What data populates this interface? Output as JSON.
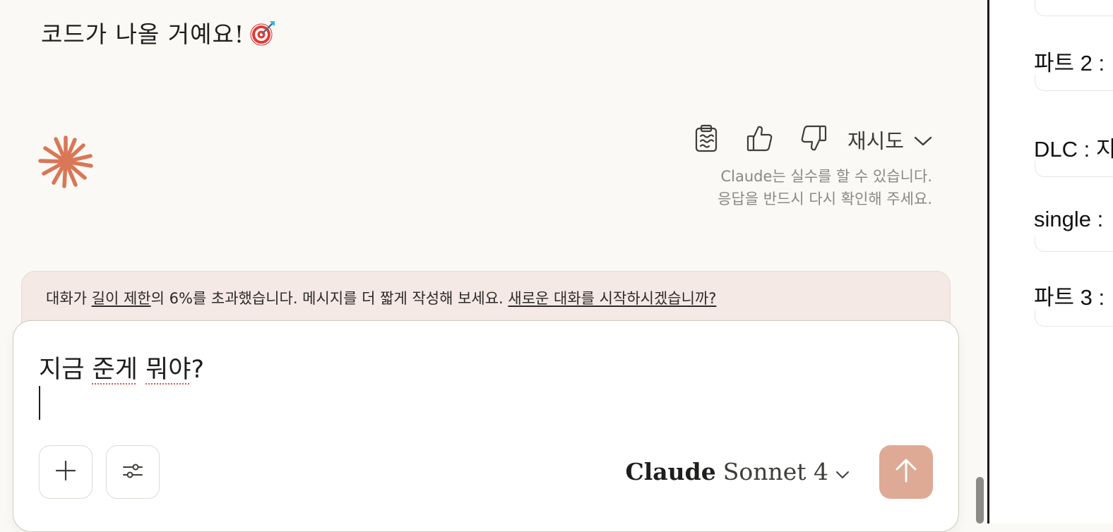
{
  "message": {
    "tail_text": "코드가 나올 거예요!",
    "emoji": "🎯"
  },
  "actions": {
    "copy_icon": "clipboard-icon",
    "thumbs_up_icon": "thumbs-up-icon",
    "thumbs_down_icon": "thumbs-down-icon",
    "retry_label": "재시도",
    "disclaimer_line1": "Claude는 실수를 할 수 있습니다.",
    "disclaimer_line2": "응답을 반드시 다시 확인해 주세요."
  },
  "warning": {
    "prefix": "대화가 ",
    "link1": "길이 제한",
    "middle": "의 6%를 초과했습니다. 메시지를 더 짧게 작성해 보세요. ",
    "link2": "새로운 대화를 시작하시겠습니까?"
  },
  "composer": {
    "word1": "지금",
    "word2": "준게",
    "word3": "뭐야",
    "punct": "?",
    "model_name_bold": "Claude",
    "model_name_rest": "Sonnet 4",
    "add_icon": "plus-icon",
    "tools_icon": "sliders-icon",
    "send_icon": "arrow-up-icon"
  },
  "sidebar": {
    "items": [
      {
        "label": "파트 2 :"
      },
      {
        "label": "DLC : 지"
      },
      {
        "label": "single :"
      },
      {
        "label": "파트 3 :"
      }
    ]
  },
  "colors": {
    "background": "#faf9f5",
    "accent": "#d97757",
    "send_button": "#deaa96",
    "warning_bg": "#f5e9e5"
  }
}
